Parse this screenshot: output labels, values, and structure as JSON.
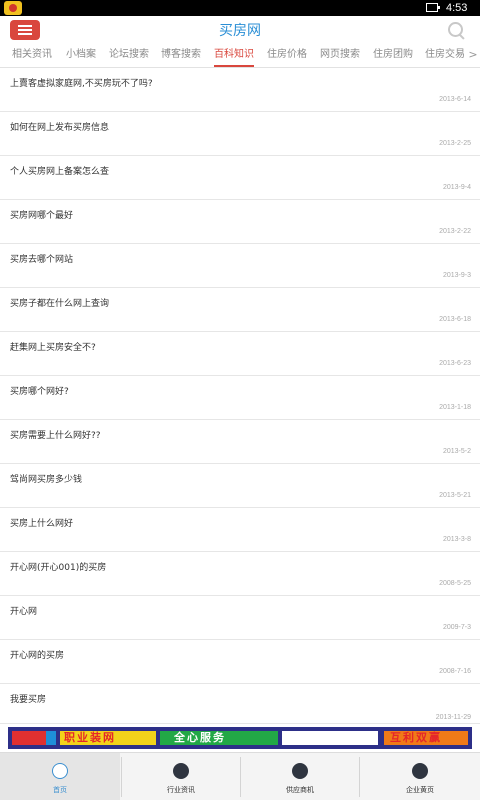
{
  "status_bar": {
    "time": "4:53"
  },
  "app_bar": {
    "title": "买房网"
  },
  "tabs": [
    {
      "label": "相关资讯",
      "active": false
    },
    {
      "label": "小档案",
      "active": false
    },
    {
      "label": "论坛搜索",
      "active": false
    },
    {
      "label": "博客搜索",
      "active": false
    },
    {
      "label": "百科知识",
      "active": true
    },
    {
      "label": "住房价格",
      "active": false
    },
    {
      "label": "网页搜索",
      "active": false
    },
    {
      "label": "住房团购",
      "active": false
    },
    {
      "label": "住房交易",
      "active": false
    }
  ],
  "tab_more_icon": ">",
  "articles": [
    {
      "title": "上賣客虚拟家庭网,不买房玩不了吗?",
      "date": "2013-6-14"
    },
    {
      "title": "如何在网上发布买房信息",
      "date": "2013-2-25"
    },
    {
      "title": "个人买房网上备案怎么查",
      "date": "2013-9-4"
    },
    {
      "title": "买房网哪个最好",
      "date": "2013-2-22"
    },
    {
      "title": "买房去哪个网站",
      "date": "2013-9-3"
    },
    {
      "title": "买房子都在什么网上查询",
      "date": "2013-6-18"
    },
    {
      "title": "赶集网上买房安全不?",
      "date": "2013-6-23"
    },
    {
      "title": "买房哪个网好?",
      "date": "2013-1-18"
    },
    {
      "title": "买房需要上什么网好??",
      "date": "2013-5-2"
    },
    {
      "title": "驾尚网买房多少钱",
      "date": "2013-5-21"
    },
    {
      "title": "买房上什么网好",
      "date": "2013-3-8"
    },
    {
      "title": "开心网(开心001)的买房",
      "date": "2008-5-25"
    },
    {
      "title": "开心网",
      "date": "2009-7-3"
    },
    {
      "title": "开心网的买房",
      "date": "2008-7-16"
    },
    {
      "title": "我要买房",
      "date": "2013-11-29"
    }
  ],
  "banner": {
    "segments": [
      "职业装网",
      "全心服务",
      "诚挚合作",
      "互利双赢"
    ],
    "colors": {
      "background": "#2d2f88",
      "blocks": [
        "#e03030",
        "#f2d21a",
        "#22a846",
        "#f07a18",
        "#1e8fd8",
        "#ffffff"
      ],
      "text_red": "#e5262a",
      "text_white": "#ffffff"
    }
  },
  "bottom_nav": [
    {
      "label": "首页",
      "icon": "home-icon",
      "active": true
    },
    {
      "label": "行业资讯",
      "icon": "book-icon",
      "active": false
    },
    {
      "label": "供应商机",
      "icon": "chat-icon",
      "active": false
    },
    {
      "label": "企业黄页",
      "icon": "document-icon",
      "active": false
    }
  ],
  "colors": {
    "accent": "#d9473d",
    "title_blue": "#2b8fd6",
    "nav_active": "#3a8fd0"
  }
}
